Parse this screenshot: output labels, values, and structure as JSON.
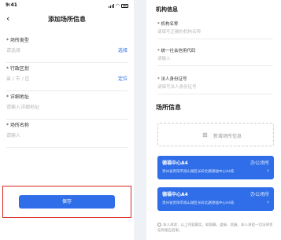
{
  "left": {
    "status": {
      "time": "9:41"
    },
    "nav": {
      "back": "‹",
      "title": "添加场所信息"
    },
    "fields": [
      {
        "label": "* 场所类型",
        "value": "请选择",
        "action": "选择"
      },
      {
        "label": "* 行政区划",
        "value": "省 / 市 / 区",
        "action": "定位"
      },
      {
        "label": "* 详细地址",
        "value": "请输入详细地址",
        "action": ""
      },
      {
        "label": "* 场所名称",
        "value": "请输入",
        "action": ""
      }
    ],
    "save_label": "保存"
  },
  "right": {
    "org_section_title": "机构信息",
    "org_fields": [
      {
        "label": "* 机构名称",
        "value": "请填写正确的机构名称"
      },
      {
        "label": "* 统一社会信用代码",
        "value": "请输入"
      },
      {
        "label": "* 法人身份证号",
        "value": "请填写法人身份证号"
      }
    ],
    "place_section_title": "场所信息",
    "add_label": "新增场所信息",
    "cards": [
      {
        "name": "德福中心A4",
        "action": "办公场所",
        "address": "贵州省贵阳市观山湖区长岭北路德福中心A4栋"
      },
      {
        "name": "德福中心A4",
        "action": "办公场所",
        "address": "贵州省贵阳市观山湖区长岭北路德福中心A4栋"
      }
    ],
    "agreement": "本人承诺：以上内容属实，如隐瞒、虚报、谎报，本人承担一切法律责任和相应后果。"
  },
  "colors": {
    "primary": "#2f6ee8",
    "highlight_border": "#d9261c"
  }
}
